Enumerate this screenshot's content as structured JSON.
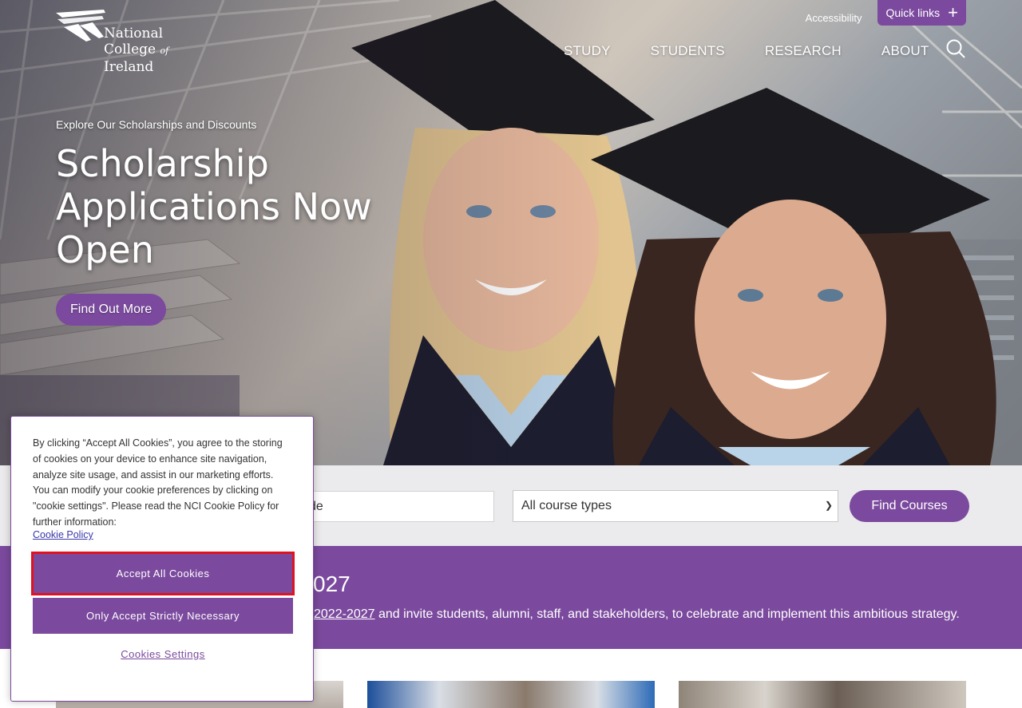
{
  "brand": {
    "logo_lines": [
      "National",
      "College",
      "of",
      "Ireland"
    ],
    "accent_color": "#7b4a9e"
  },
  "topbar": {
    "accessibility": "Accessibility",
    "quick_links": "Quick links",
    "quick_links_icon": "plus-icon"
  },
  "nav": {
    "items": [
      "STUDY",
      "STUDENTS",
      "RESEARCH",
      "ABOUT"
    ],
    "search_icon": "search-icon"
  },
  "hero": {
    "eyebrow": "Explore Our Scholarships and Discounts",
    "headline": "Scholarship Applications Now Open",
    "cta": "Find Out More"
  },
  "course_search": {
    "keyword_visible_text": "de",
    "course_type": "All course types",
    "submit": "Find Courses"
  },
  "strategy": {
    "heading_visible": "027",
    "link_visible": "2022-2027",
    "text_after_link": " and invite students, alumni, staff, and stakeholders, to celebrate and implement this ambitious strategy."
  },
  "cookie_banner": {
    "text": "By clicking “Accept All Cookies”, you agree to the storing of cookies on your device to enhance site navigation, analyze site usage, and assist in our marketing efforts. You can modify your cookie preferences by clicking on \"cookie settings\". Please read the NCI Cookie Policy for further information:",
    "policy_link": "Cookie Policy",
    "accept_all": "Accept All Cookies",
    "strictly_necessary": "Only Accept Strictly Necessary",
    "settings": "Cookies Settings"
  }
}
